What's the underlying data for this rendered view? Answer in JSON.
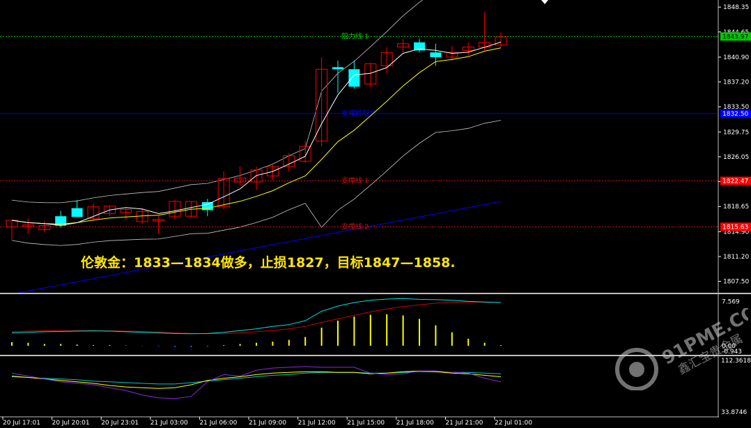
{
  "annotation": "伦敦金：1833—1834做多，止损1827，目标1847—1858.",
  "watermark": {
    "brand": "91PME.COM",
    "subtitle": "鑫汇宝贵金属"
  },
  "chart_data": {
    "type": "candlestick",
    "symbol_panel": {
      "price_ticks": [
        "1848.35",
        "1844.65",
        "1840.90",
        "1837.20",
        "1833.50",
        "1829.75",
        "1826.05",
        "1822.35",
        "1818.65",
        "1814.90",
        "1811.20",
        "1807.50"
      ],
      "ylim": [
        1805.8,
        1849.2
      ],
      "candles": [
        {
          "o": 1815.6,
          "h": 1816.6,
          "l": 1813.6,
          "c": 1816.6
        },
        {
          "o": 1815.7,
          "h": 1816.9,
          "l": 1814.6,
          "c": 1815.9
        },
        {
          "o": 1815.2,
          "h": 1816.5,
          "l": 1814.8,
          "c": 1815.8
        },
        {
          "o": 1817.2,
          "h": 1818.0,
          "l": 1815.5,
          "c": 1815.8
        },
        {
          "o": 1818.4,
          "h": 1819.6,
          "l": 1817.1,
          "c": 1817.1
        },
        {
          "o": 1816.9,
          "h": 1819.1,
          "l": 1816.6,
          "c": 1818.6
        },
        {
          "o": 1817.6,
          "h": 1818.8,
          "l": 1817.2,
          "c": 1818.7
        },
        {
          "o": 1817.8,
          "h": 1818.4,
          "l": 1816.6,
          "c": 1818.2
        },
        {
          "o": 1816.4,
          "h": 1818.4,
          "l": 1816.1,
          "c": 1817.9
        },
        {
          "o": 1816.7,
          "h": 1817.2,
          "l": 1814.6,
          "c": 1816.7
        },
        {
          "o": 1817.2,
          "h": 1819.6,
          "l": 1816.8,
          "c": 1819.4
        },
        {
          "o": 1817.2,
          "h": 1819.4,
          "l": 1817.0,
          "c": 1819.4
        },
        {
          "o": 1819.3,
          "h": 1819.8,
          "l": 1817.2,
          "c": 1818.1
        },
        {
          "o": 1818.6,
          "h": 1823.9,
          "l": 1818.2,
          "c": 1822.8
        },
        {
          "o": 1822.3,
          "h": 1824.6,
          "l": 1821.8,
          "c": 1822.9
        },
        {
          "o": 1822.3,
          "h": 1824.6,
          "l": 1821.1,
          "c": 1824.1
        },
        {
          "o": 1823.2,
          "h": 1824.8,
          "l": 1822.6,
          "c": 1824.6
        },
        {
          "o": 1824.6,
          "h": 1826.6,
          "l": 1823.8,
          "c": 1826.2
        },
        {
          "o": 1825.4,
          "h": 1828.4,
          "l": 1825.1,
          "c": 1827.6
        },
        {
          "o": 1828.4,
          "h": 1840.9,
          "l": 1827.6,
          "c": 1839.1
        },
        {
          "o": 1839.4,
          "h": 1840.4,
          "l": 1835.6,
          "c": 1839.1
        },
        {
          "o": 1839.1,
          "h": 1840.4,
          "l": 1836.2,
          "c": 1836.5
        },
        {
          "o": 1836.9,
          "h": 1840.1,
          "l": 1836.4,
          "c": 1839.9
        },
        {
          "o": 1839.6,
          "h": 1842.4,
          "l": 1838.4,
          "c": 1841.6
        },
        {
          "o": 1842.4,
          "h": 1843.6,
          "l": 1841.6,
          "c": 1842.9
        },
        {
          "o": 1843.1,
          "h": 1843.6,
          "l": 1841.6,
          "c": 1841.9
        },
        {
          "o": 1841.6,
          "h": 1842.9,
          "l": 1839.6,
          "c": 1840.9
        },
        {
          "o": 1840.9,
          "h": 1842.6,
          "l": 1840.3,
          "c": 1841.6
        },
        {
          "o": 1841.9,
          "h": 1843.1,
          "l": 1841.1,
          "c": 1842.4
        },
        {
          "o": 1842.4,
          "h": 1847.6,
          "l": 1841.9,
          "c": 1843.1
        },
        {
          "o": 1842.7,
          "h": 1844.6,
          "l": 1842.4,
          "c": 1843.9
        }
      ],
      "horizontal_lines": [
        {
          "name": "阻力线 1",
          "price": "1843.97",
          "value": 1843.97,
          "color": "#00c800",
          "tag_color": "#00c800",
          "style": "dotted"
        },
        {
          "name": "支撑转阻力",
          "price": "1832.50",
          "value": 1832.5,
          "color": "#0000ff",
          "tag_color": "#0000ff",
          "style": "solid"
        },
        {
          "name": "支撑线 1",
          "price": "1822.47",
          "value": 1822.47,
          "color": "#d01010",
          "tag_color": "#ff0000",
          "style": "dotted"
        },
        {
          "name": "支撑线 2",
          "price": "1815.63",
          "value": 1815.63,
          "color": "#d01010",
          "tag_color": "#ff0000",
          "style": "dotted"
        }
      ],
      "colors": {
        "bull": "#ff0000",
        "bear": "#00ffff",
        "ma_fast": "#ffffff",
        "ma_slow": "#ffff00",
        "bands": "#c8c8c8",
        "ma_long": "#0000ff"
      }
    },
    "macd_panel": {
      "ticks": [
        "7.569",
        "0.00",
        "-0.943"
      ],
      "ylim": [
        -1.2,
        8.6
      ],
      "histogram": [
        0.6,
        0.5,
        0.3,
        0.3,
        0.2,
        0.1,
        0.1,
        0.05,
        -0.05,
        -0.1,
        -0.2,
        -0.25,
        -0.15,
        0.1,
        0.3,
        0.5,
        0.7,
        1.0,
        1.5,
        3.1,
        4.3,
        5.0,
        5.3,
        5.4,
        5.2,
        4.6,
        3.5,
        2.3,
        1.2,
        0.5,
        0.1
      ],
      "signal": [
        2.4,
        2.5,
        2.55,
        2.6,
        2.6,
        2.6,
        2.55,
        2.5,
        2.45,
        2.35,
        2.2,
        2.1,
        2.05,
        2.1,
        2.2,
        2.4,
        2.6,
        2.9,
        3.3,
        4.0,
        4.6,
        5.2,
        5.8,
        6.3,
        6.7,
        7.0,
        7.3,
        7.45,
        7.5,
        7.45,
        7.4
      ],
      "macd": [
        2.2,
        2.3,
        2.4,
        2.45,
        2.5,
        2.55,
        2.5,
        2.4,
        2.3,
        2.2,
        2.1,
        2.05,
        2.1,
        2.3,
        2.6,
        2.9,
        3.3,
        3.6,
        4.3,
        5.9,
        6.8,
        7.4,
        7.8,
        8.0,
        8.1,
        7.95,
        7.9,
        7.8,
        7.6,
        7.5,
        7.4
      ],
      "colors": {
        "histogram": "#ffff00",
        "histogram_neg": "#0070ff",
        "macd": "#00e0e0",
        "signal": "#d00000"
      }
    },
    "oscillator_panel": {
      "ticks": [
        "112.3618",
        "33.8746"
      ],
      "ylim": [
        33.8746,
        112.3618
      ],
      "line_purple": [
        92,
        88,
        84,
        80,
        78,
        76,
        72,
        68,
        62,
        58,
        57,
        60,
        80,
        90,
        88,
        96,
        99,
        100,
        101,
        100,
        100,
        100,
        92,
        90,
        91,
        95,
        95,
        93,
        92,
        85,
        80
      ],
      "line_yellow": [
        88,
        86,
        84,
        82,
        80,
        78,
        75,
        73,
        72,
        71,
        72,
        76,
        82,
        85,
        87,
        90,
        92,
        93,
        94,
        94,
        93,
        93,
        91,
        92,
        94,
        95,
        94,
        92,
        91,
        89,
        87
      ],
      "line_cyan": [
        87,
        86,
        85,
        84,
        83,
        81,
        80,
        79,
        78,
        77,
        77,
        79,
        81,
        83,
        85,
        87,
        89,
        90,
        92,
        93,
        93,
        93,
        92,
        92,
        93,
        94,
        94,
        93,
        93,
        92,
        91
      ],
      "colors": {
        "purple": "#8a2be2",
        "yellow": "#ffff00",
        "cyan": "#00c8c8"
      }
    },
    "x_labels": [
      "20 Jul 17:01",
      "20 Jul 20:01",
      "20 Jul 23:01",
      "21 Jul 03:00",
      "21 Jul 06:00",
      "21 Jul 09:00",
      "21 Jul 12:00",
      "21 Jul 15:00",
      "21 Jul 18:00",
      "21 Jul 21:00",
      "22 Jul 01:00"
    ]
  }
}
